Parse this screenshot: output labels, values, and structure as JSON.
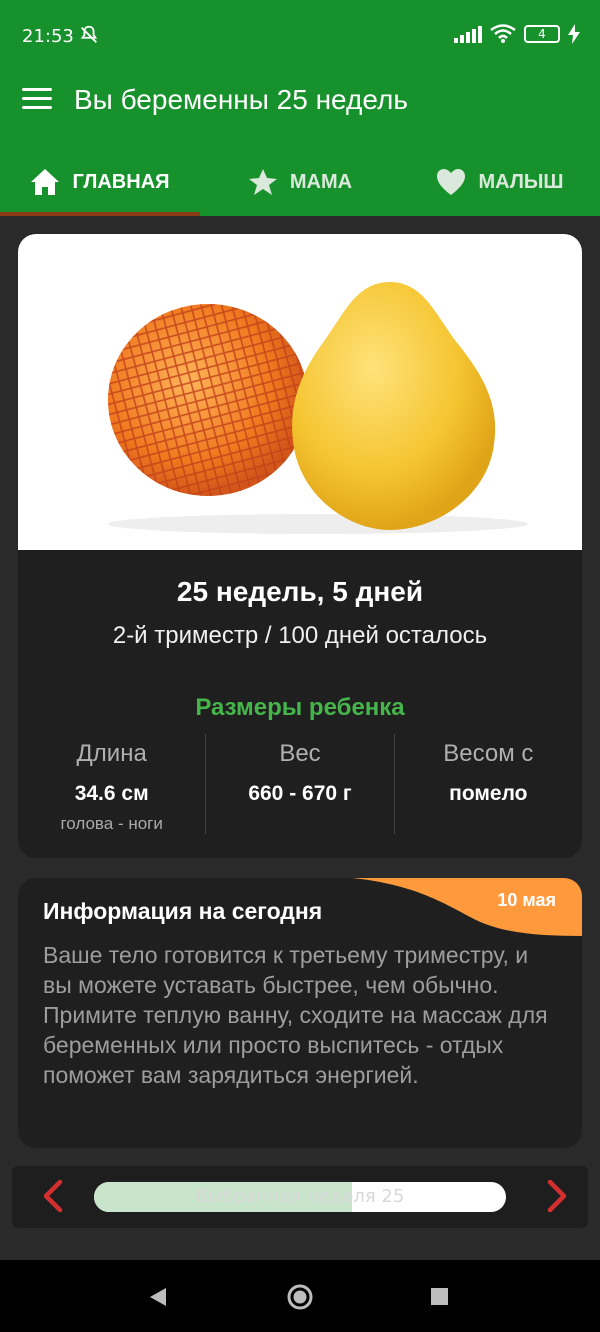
{
  "status_bar": {
    "time": "21:53",
    "battery": "4"
  },
  "app_bar": {
    "title": "Вы беременны 25 недель"
  },
  "tabs": [
    {
      "label": "ГЛАВНАЯ",
      "icon": "home-icon"
    },
    {
      "label": "МАМА",
      "icon": "star-icon"
    },
    {
      "label": "МАЛЫШ",
      "icon": "heart-icon"
    }
  ],
  "summary": {
    "week_title": "25 недель, 5 дней",
    "subtitle": "2-й триместр / 100 дней осталось",
    "sizes_title": "Размеры ребенка",
    "stats": [
      {
        "label": "Длина",
        "value": "34.6 см",
        "sub": "голова - ноги"
      },
      {
        "label": "Вес",
        "value": "660 - 670 г",
        "sub": ""
      },
      {
        "label": "Весом с",
        "value": "помело",
        "sub": ""
      }
    ]
  },
  "info": {
    "title": "Информация на сегодня",
    "date": "10 мая",
    "text": "Ваше тело готовится к третьему триместру, и вы можете уставать быстрее, чем обычно. Примите теплую ванну, сходите на массаж для беременных или просто выспитесь - отдых поможет вам зарядиться энергией."
  },
  "week_selector": {
    "label": "Выбранная неделя 25",
    "progress": 0.625
  },
  "colors": {
    "primary": "#17912c",
    "accent": "#45b54b",
    "badge": "#ff9a3c",
    "arrow": "#d32f2f"
  }
}
